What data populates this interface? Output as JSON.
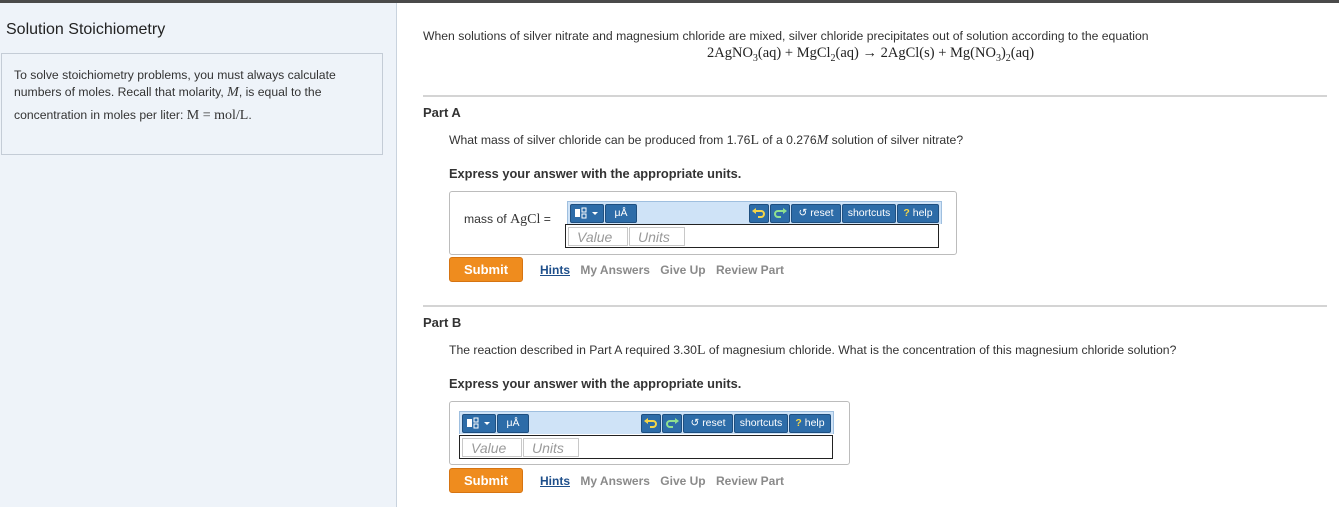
{
  "sidebar": {
    "title": "Solution Stoichiometry",
    "hint_line1": "To solve stoichiometry problems, you must always calculate",
    "hint_line2_pre": "numbers of moles. Recall that molarity,",
    "hint_line2_var": "M",
    "hint_line2_post": ", is equal to the",
    "hint_line3_pre": "concentration in moles per liter:",
    "hint_line3_math": "M = mol/L",
    "hint_line3_post": "."
  },
  "intro": {
    "text": "When solutions of silver nitrate and magnesium chloride are mixed, silver chloride precipitates out of solution according to the equation",
    "eq_a": "2AgNO",
    "eq_a_sub": "3",
    "eq_b": "(aq) + MgCl",
    "eq_b_sub": "2",
    "eq_c": "(aq) → 2AgCl(s) + Mg(NO",
    "eq_c_sub1": "3",
    "eq_d": ")",
    "eq_d_sub": "2",
    "eq_e": "(aq)"
  },
  "toolbar": {
    "reset": "reset",
    "shortcuts": "shortcuts",
    "help": "help",
    "units_btn": "μÅ"
  },
  "partA": {
    "label": "Part A",
    "question_pre": "What mass of silver chloride can be produced from 1.76",
    "question_unit": "L",
    "question_mid": " of a 0.276",
    "question_var": "M",
    "question_post": " solution of silver nitrate?",
    "instruction": "Express your answer with the appropriate units.",
    "answer_label_pre": "mass of ",
    "answer_label_math": "AgCl",
    "answer_label_post": " =",
    "value_placeholder": "Value",
    "units_placeholder": "Units",
    "submit": "Submit",
    "links": [
      "Hints",
      "My Answers",
      "Give Up",
      "Review Part"
    ]
  },
  "partB": {
    "label": "Part B",
    "question_pre": "The reaction described in Part A required 3.30",
    "question_unit": "L",
    "question_post": " of magnesium chloride. What is the concentration of this magnesium chloride solution?",
    "instruction": "Express your answer with the appropriate units.",
    "value_placeholder": "Value",
    "units_placeholder": "Units",
    "submit": "Submit",
    "links": [
      "Hints",
      "My Answers",
      "Give Up",
      "Review Part"
    ]
  },
  "colors": {
    "submit": "#ef8c1e",
    "toolbar_button": "#2d6ca8",
    "sidebar_bg": "#eef3f9"
  }
}
